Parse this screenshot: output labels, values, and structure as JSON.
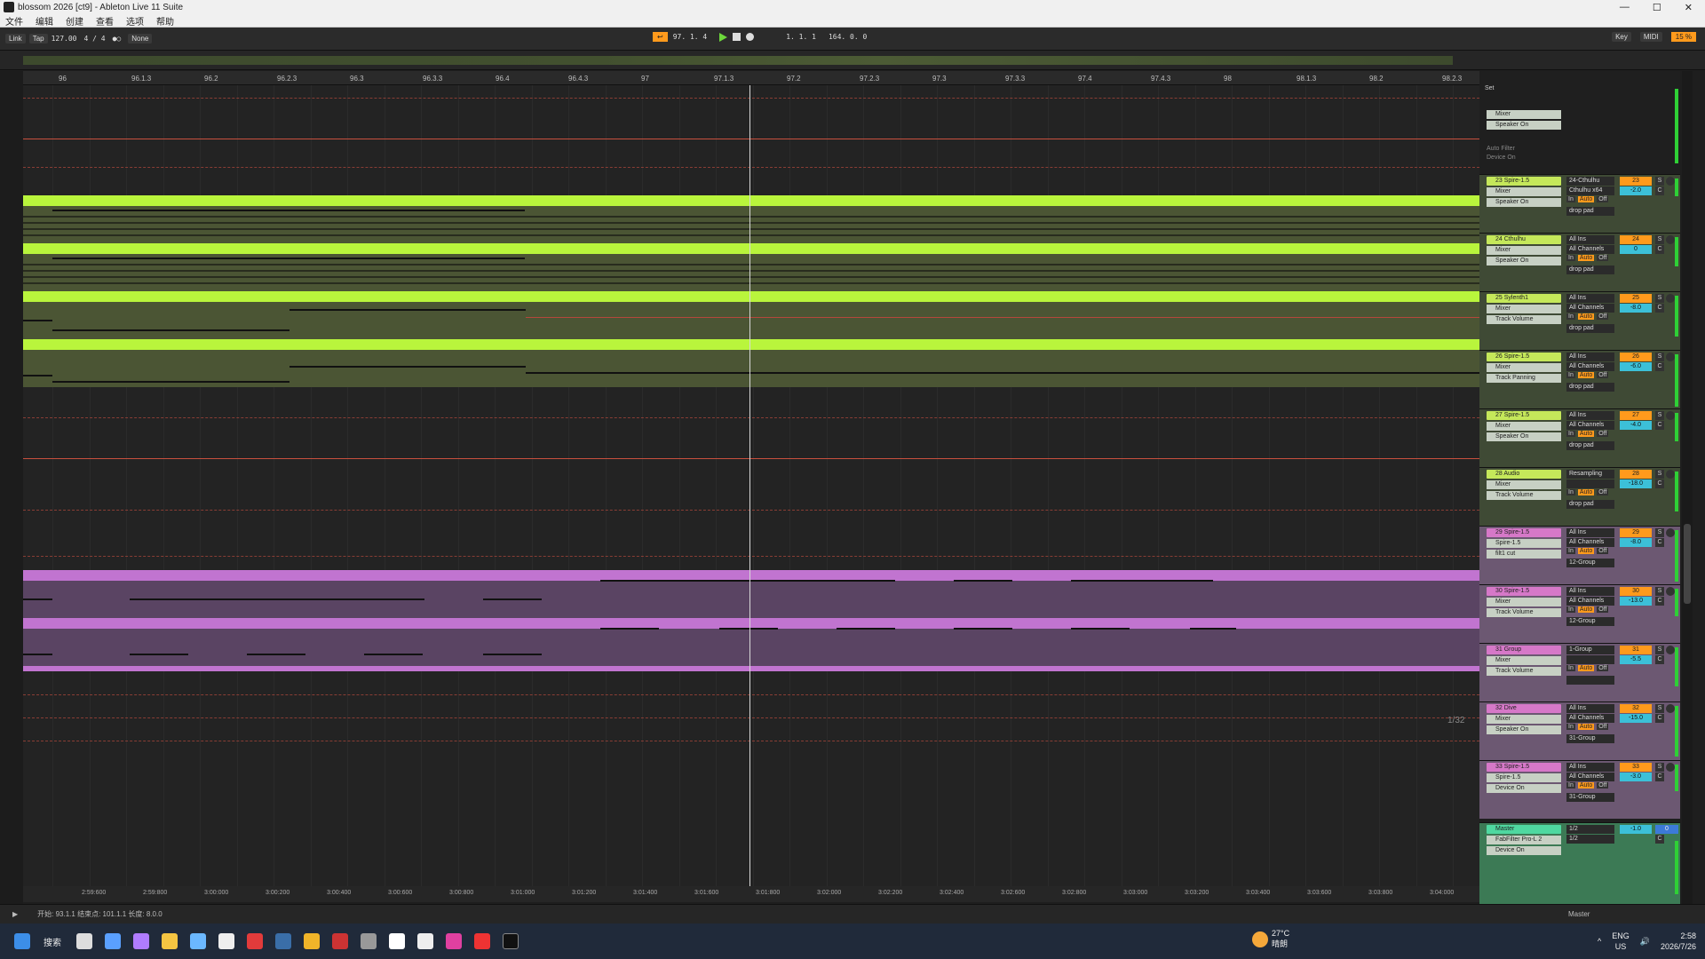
{
  "window": {
    "title": "blossom 2026  [ct9] - Ableton Live 11 Suite",
    "controls": [
      "—",
      "☐",
      "✕"
    ]
  },
  "menu": [
    "文件",
    "编辑",
    "创建",
    "查看",
    "选项",
    "帮助"
  ],
  "transport": {
    "link": "Link",
    "tap": "Tap",
    "tempo": "127.00",
    "meter": "4 / 4",
    "quantize": "None",
    "position": "97. 1. 4",
    "loop_start": "1. 1. 1",
    "loop_length": "164. 0. 0",
    "key": "Key",
    "midi": "MIDI",
    "cpu": "15 %"
  },
  "ruler": [
    "96",
    "96.1.3",
    "96.2",
    "96.2.3",
    "96.3",
    "96.3.3",
    "96.4",
    "96.4.3",
    "97",
    "97.1.3",
    "97.2",
    "97.2.3",
    "97.3",
    "97.3.3",
    "97.4",
    "97.4.3",
    "98",
    "98.1.3",
    "98.2",
    "98.2.3"
  ],
  "timebar": [
    "2:59:600",
    "2:59:800",
    "3:00:000",
    "3:00:200",
    "3:00:400",
    "3:00:600",
    "3:00:800",
    "3:01:000",
    "3:01:200",
    "3:01:400",
    "3:01:600",
    "3:01:800",
    "3:02:000",
    "3:02:200",
    "3:02:400",
    "3:02:600",
    "3:02:800",
    "3:03:000",
    "3:03:200",
    "3:03:400",
    "3:03:600",
    "3:03:800",
    "3:04:000"
  ],
  "zoom_ratio": "1/32",
  "set_label": "Set",
  "mixer_top": {
    "device": "Mixer",
    "param": "Speaker On",
    "auto_filter": "Auto Filter",
    "device_on": "Device On"
  },
  "tracks": [
    {
      "name": "23 Spire-1.5",
      "input": "24-Cthulhu",
      "sub": "Cthulhu x64",
      "dev": "Mixer",
      "param": "Speaker On",
      "num": "23",
      "vol": "-2.0",
      "group": "drop pad",
      "color": "#c5e85a"
    },
    {
      "name": "24 Cthulhu",
      "input": "All Ins",
      "sub": "All Channels",
      "dev": "Mixer",
      "param": "Speaker On",
      "num": "24",
      "vol": "0",
      "group": "drop pad",
      "color": "#c5e85a"
    },
    {
      "name": "25 Sylenth1",
      "input": "All Ins",
      "sub": "All Channels",
      "dev": "Mixer",
      "param": "Track Volume",
      "num": "25",
      "vol": "-8.0",
      "group": "drop pad",
      "color": "#c5e85a"
    },
    {
      "name": "26 Spire-1.5",
      "input": "All Ins",
      "sub": "All Channels",
      "dev": "Mixer",
      "param": "Track Panning",
      "num": "26",
      "vol": "-6.0",
      "group": "drop pad",
      "color": "#c5e85a"
    },
    {
      "name": "27 Spire-1.5",
      "input": "All Ins",
      "sub": "All Channels",
      "dev": "Mixer",
      "param": "Speaker On",
      "num": "27",
      "vol": "-4.0",
      "group": "drop pad",
      "color": "#c5e85a"
    },
    {
      "name": "28 Audio",
      "input": "Resampling",
      "sub": "",
      "dev": "Mixer",
      "param": "Track Volume",
      "num": "28",
      "vol": "-18.0",
      "group": "drop pad",
      "color": "#c5e85a"
    },
    {
      "name": "29 Spire-1.5",
      "input": "All Ins",
      "sub": "All Channels",
      "dev": "Spire-1.5",
      "param": "filt1 cut",
      "num": "29",
      "vol": "-8.0",
      "group": "12-Group",
      "color": "#d678c8"
    },
    {
      "name": "30 Spire-1.5",
      "input": "All Ins",
      "sub": "All Channels",
      "dev": "Mixer",
      "param": "Track Volume",
      "num": "30",
      "vol": "-13.0",
      "group": "12-Group",
      "color": "#d678c8"
    },
    {
      "name": "31 Group",
      "input": "1-Group",
      "sub": "",
      "dev": "Mixer",
      "param": "Track Volume",
      "num": "31",
      "vol": "-5.5",
      "group": "",
      "color": "#d678c8"
    },
    {
      "name": "32 Dive",
      "input": "All Ins",
      "sub": "All Channels",
      "dev": "Mixer",
      "param": "Speaker On",
      "num": "32",
      "vol": "-15.0",
      "group": "31-Group",
      "color": "#d678c8"
    },
    {
      "name": "33 Spire-1.5",
      "input": "All Ins",
      "sub": "All Channels",
      "dev": "Spire-1.5",
      "param": "Device On",
      "num": "33",
      "vol": "-3.0",
      "group": "31-Group",
      "color": "#d678c8"
    }
  ],
  "io_labels": {
    "in": "In",
    "auto": "Auto",
    "off": "Off",
    "s": "S",
    "c": "C"
  },
  "master": {
    "name": "Master",
    "dev": "FabFilter Pro-L 2",
    "param": "Device On",
    "out1": "1/2",
    "out2": "1/2",
    "vol": "-1.0",
    "num": "0"
  },
  "status": {
    "text": "开始: 93.1.1  结束点: 101.1.1  长度: 8.0.0",
    "master": "Master"
  },
  "taskbar": {
    "search": "搜索",
    "weather_temp": "27°C",
    "weather_desc": "晴朗",
    "lang1": "ENG",
    "lang2": "US",
    "time": "2:58",
    "date": "2026/7/26"
  }
}
